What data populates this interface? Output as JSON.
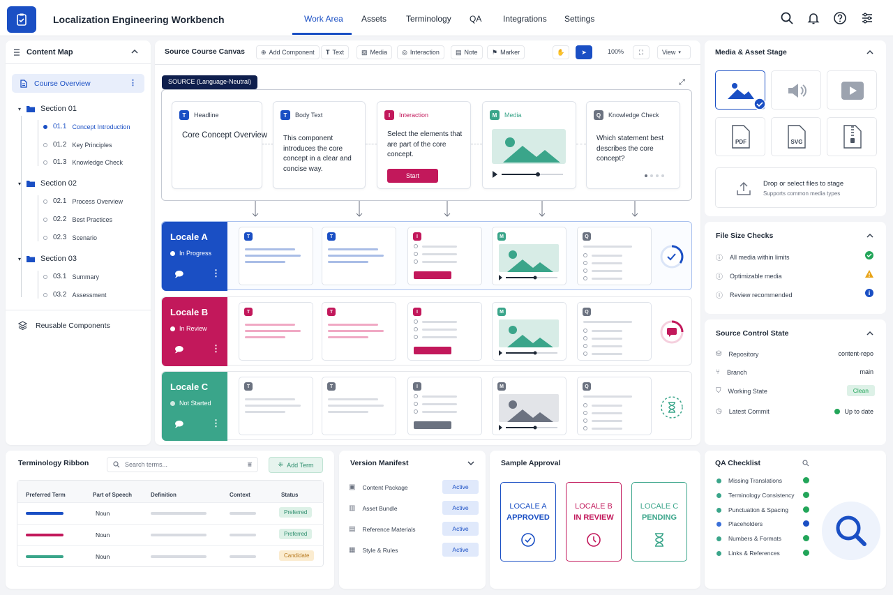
{
  "app": {
    "title": "Localization Engineering Workbench"
  },
  "nav": {
    "tabs": [
      "Work Area",
      "Assets",
      "Terminology",
      "QA",
      "Integrations",
      "Settings"
    ],
    "active": "Work Area"
  },
  "sidebar": {
    "title": "Content Map",
    "overview": "Course Overview",
    "sections": [
      {
        "label": "Section 01",
        "items": [
          {
            "num": "01.1",
            "label": "Concept Introduction"
          },
          {
            "num": "01.2",
            "label": "Key Principles"
          },
          {
            "num": "01.3",
            "label": "Knowledge Check"
          }
        ]
      },
      {
        "label": "Section 02",
        "items": [
          {
            "num": "02.1",
            "label": "Process Overview"
          },
          {
            "num": "02.2",
            "label": "Best Practices"
          },
          {
            "num": "02.3",
            "label": "Scenario"
          }
        ]
      },
      {
        "label": "Section 03",
        "items": [
          {
            "num": "03.1",
            "label": "Summary"
          },
          {
            "num": "03.2",
            "label": "Assessment"
          }
        ]
      }
    ],
    "reusable": "Reusable Components"
  },
  "canvas": {
    "title": "Source Course Canvas",
    "toolbar": {
      "add_component": "Add Component",
      "text": "Text",
      "media": "Media",
      "interaction": "Interaction",
      "note": "Note",
      "marker": "Marker",
      "zoom": "100%",
      "view": "View"
    },
    "source_label": "SOURCE (Language-Neutral)",
    "cards": [
      {
        "badge": "T",
        "type": "Headline",
        "body": "Core Concept Overview",
        "color": "#1a4fc4"
      },
      {
        "badge": "T",
        "type": "Body Text",
        "body": "This component introduces the core concept in a clear and concise way.",
        "color": "#1a4fc4"
      },
      {
        "badge": "I",
        "type": "Interaction",
        "body": "Select the elements that are part of the core concept.",
        "button": "Start",
        "color": "#c2185b"
      },
      {
        "badge": "M",
        "type": "Media",
        "color": "#3aa58a"
      },
      {
        "badge": "Q",
        "type": "Knowledge Check",
        "body": "Which statement best describes the core concept?",
        "color": "#6b7280"
      }
    ],
    "locales": [
      {
        "name": "Locale A",
        "status": "In Progress",
        "color": "#1a4fc4"
      },
      {
        "name": "Locale B",
        "status": "In Review",
        "color": "#c2185b"
      },
      {
        "name": "Locale C",
        "status": "Not Started",
        "color": "#3aa58a"
      }
    ]
  },
  "media_stage": {
    "title": "Media & Asset Stage",
    "file_types": [
      "PDF",
      "SVG"
    ],
    "upload_title": "Drop or select files to stage",
    "upload_sub": "Supports common media types"
  },
  "file_checks": {
    "title": "File Size Checks",
    "items": [
      {
        "label": "All media within limits",
        "state": "ok"
      },
      {
        "label": "Optimizable media",
        "state": "warn"
      },
      {
        "label": "Review recommended",
        "state": "info"
      }
    ]
  },
  "source_control": {
    "title": "Source Control State",
    "repo_label": "Repository",
    "repo_value": "content-repo",
    "branch_label": "Branch",
    "branch_value": "main",
    "state_label": "Working State",
    "state_value": "Clean",
    "commit_label": "Latest Commit",
    "commit_value": "Up to date"
  },
  "terminology": {
    "title": "Terminology Ribbon",
    "search_placeholder": "Search terms...",
    "add_label": "Add Term",
    "columns": [
      "Preferred Term",
      "Part of Speech",
      "Definition",
      "Context",
      "Status"
    ],
    "rows": [
      {
        "pos": "Noun",
        "status": "Preferred",
        "color": "#1a4fc4"
      },
      {
        "pos": "Noun",
        "status": "Preferred",
        "color": "#c2185b"
      },
      {
        "pos": "Noun",
        "status": "Candidate",
        "color": "#3aa58a"
      }
    ]
  },
  "version_manifest": {
    "title": "Version Manifest",
    "items": [
      {
        "label": "Content Package",
        "status": "Active"
      },
      {
        "label": "Asset Bundle",
        "status": "Active"
      },
      {
        "label": "Reference Materials",
        "status": "Active"
      },
      {
        "label": "Style & Rules",
        "status": "Active"
      }
    ]
  },
  "sample_approval": {
    "title": "Sample Approval",
    "cards": [
      {
        "line1": "LOCALE A",
        "line2": "APPROVED",
        "color": "#1a4fc4"
      },
      {
        "line1": "LOCALE B",
        "line2": "IN REVIEW",
        "color": "#c2185b"
      },
      {
        "line1": "LOCALE C",
        "line2": "PENDING",
        "color": "#3aa58a"
      }
    ]
  },
  "qa_checklist": {
    "title": "QA Checklist",
    "items": [
      {
        "label": "Missing Translations",
        "state": "ok"
      },
      {
        "label": "Terminology Consistency",
        "state": "ok"
      },
      {
        "label": "Punctuation & Spacing",
        "state": "ok"
      },
      {
        "label": "Placeholders",
        "state": "info"
      },
      {
        "label": "Numbers & Formats",
        "state": "ok"
      },
      {
        "label": "Links & References",
        "state": "ok"
      }
    ]
  }
}
